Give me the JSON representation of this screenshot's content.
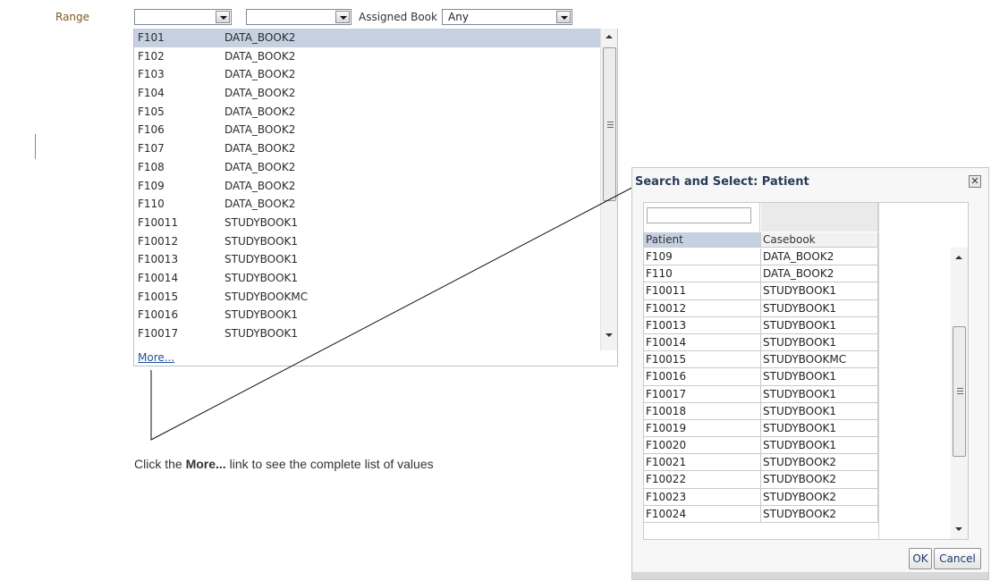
{
  "filters": {
    "range_label": "Range",
    "assigned_label": "Assigned Book",
    "assigned_value": "Any"
  },
  "dropdown": {
    "rows": [
      {
        "patient": "F101",
        "book": "DATA_BOOK2"
      },
      {
        "patient": "F102",
        "book": "DATA_BOOK2"
      },
      {
        "patient": "F103",
        "book": "DATA_BOOK2"
      },
      {
        "patient": "F104",
        "book": "DATA_BOOK2"
      },
      {
        "patient": "F105",
        "book": "DATA_BOOK2"
      },
      {
        "patient": "F106",
        "book": "DATA_BOOK2"
      },
      {
        "patient": "F107",
        "book": "DATA_BOOK2"
      },
      {
        "patient": "F108",
        "book": "DATA_BOOK2"
      },
      {
        "patient": "F109",
        "book": "DATA_BOOK2"
      },
      {
        "patient": "F110",
        "book": "DATA_BOOK2"
      },
      {
        "patient": "F10011",
        "book": "STUDYBOOK1"
      },
      {
        "patient": "F10012",
        "book": "STUDYBOOK1"
      },
      {
        "patient": "F10013",
        "book": "STUDYBOOK1"
      },
      {
        "patient": "F10014",
        "book": "STUDYBOOK1"
      },
      {
        "patient": "F10015",
        "book": "STUDYBOOKMC"
      },
      {
        "patient": "F10016",
        "book": "STUDYBOOK1"
      },
      {
        "patient": "F10017",
        "book": "STUDYBOOK1"
      }
    ],
    "more_link": "More..."
  },
  "callout": {
    "prefix": "Click the ",
    "bold": "More...",
    "suffix": " link to see the complete list of values"
  },
  "dialog": {
    "title": "Search and Select: Patient",
    "close_glyph": "✕",
    "columns": [
      "Patient",
      "Casebook"
    ],
    "rows": [
      {
        "patient": "F109",
        "casebook": "DATA_BOOK2"
      },
      {
        "patient": "F110",
        "casebook": "DATA_BOOK2"
      },
      {
        "patient": "F10011",
        "casebook": "STUDYBOOK1"
      },
      {
        "patient": "F10012",
        "casebook": "STUDYBOOK1"
      },
      {
        "patient": "F10013",
        "casebook": "STUDYBOOK1"
      },
      {
        "patient": "F10014",
        "casebook": "STUDYBOOK1"
      },
      {
        "patient": "F10015",
        "casebook": "STUDYBOOKMC"
      },
      {
        "patient": "F10016",
        "casebook": "STUDYBOOK1"
      },
      {
        "patient": "F10017",
        "casebook": "STUDYBOOK1"
      },
      {
        "patient": "F10018",
        "casebook": "STUDYBOOK1"
      },
      {
        "patient": "F10019",
        "casebook": "STUDYBOOK1"
      },
      {
        "patient": "F10020",
        "casebook": "STUDYBOOK1"
      },
      {
        "patient": "F10021",
        "casebook": "STUDYBOOK2"
      },
      {
        "patient": "F10022",
        "casebook": "STUDYBOOK2"
      },
      {
        "patient": "F10023",
        "casebook": "STUDYBOOK2"
      },
      {
        "patient": "F10024",
        "casebook": "STUDYBOOK2"
      }
    ],
    "ok_label": "OK",
    "cancel_label": "Cancel"
  }
}
